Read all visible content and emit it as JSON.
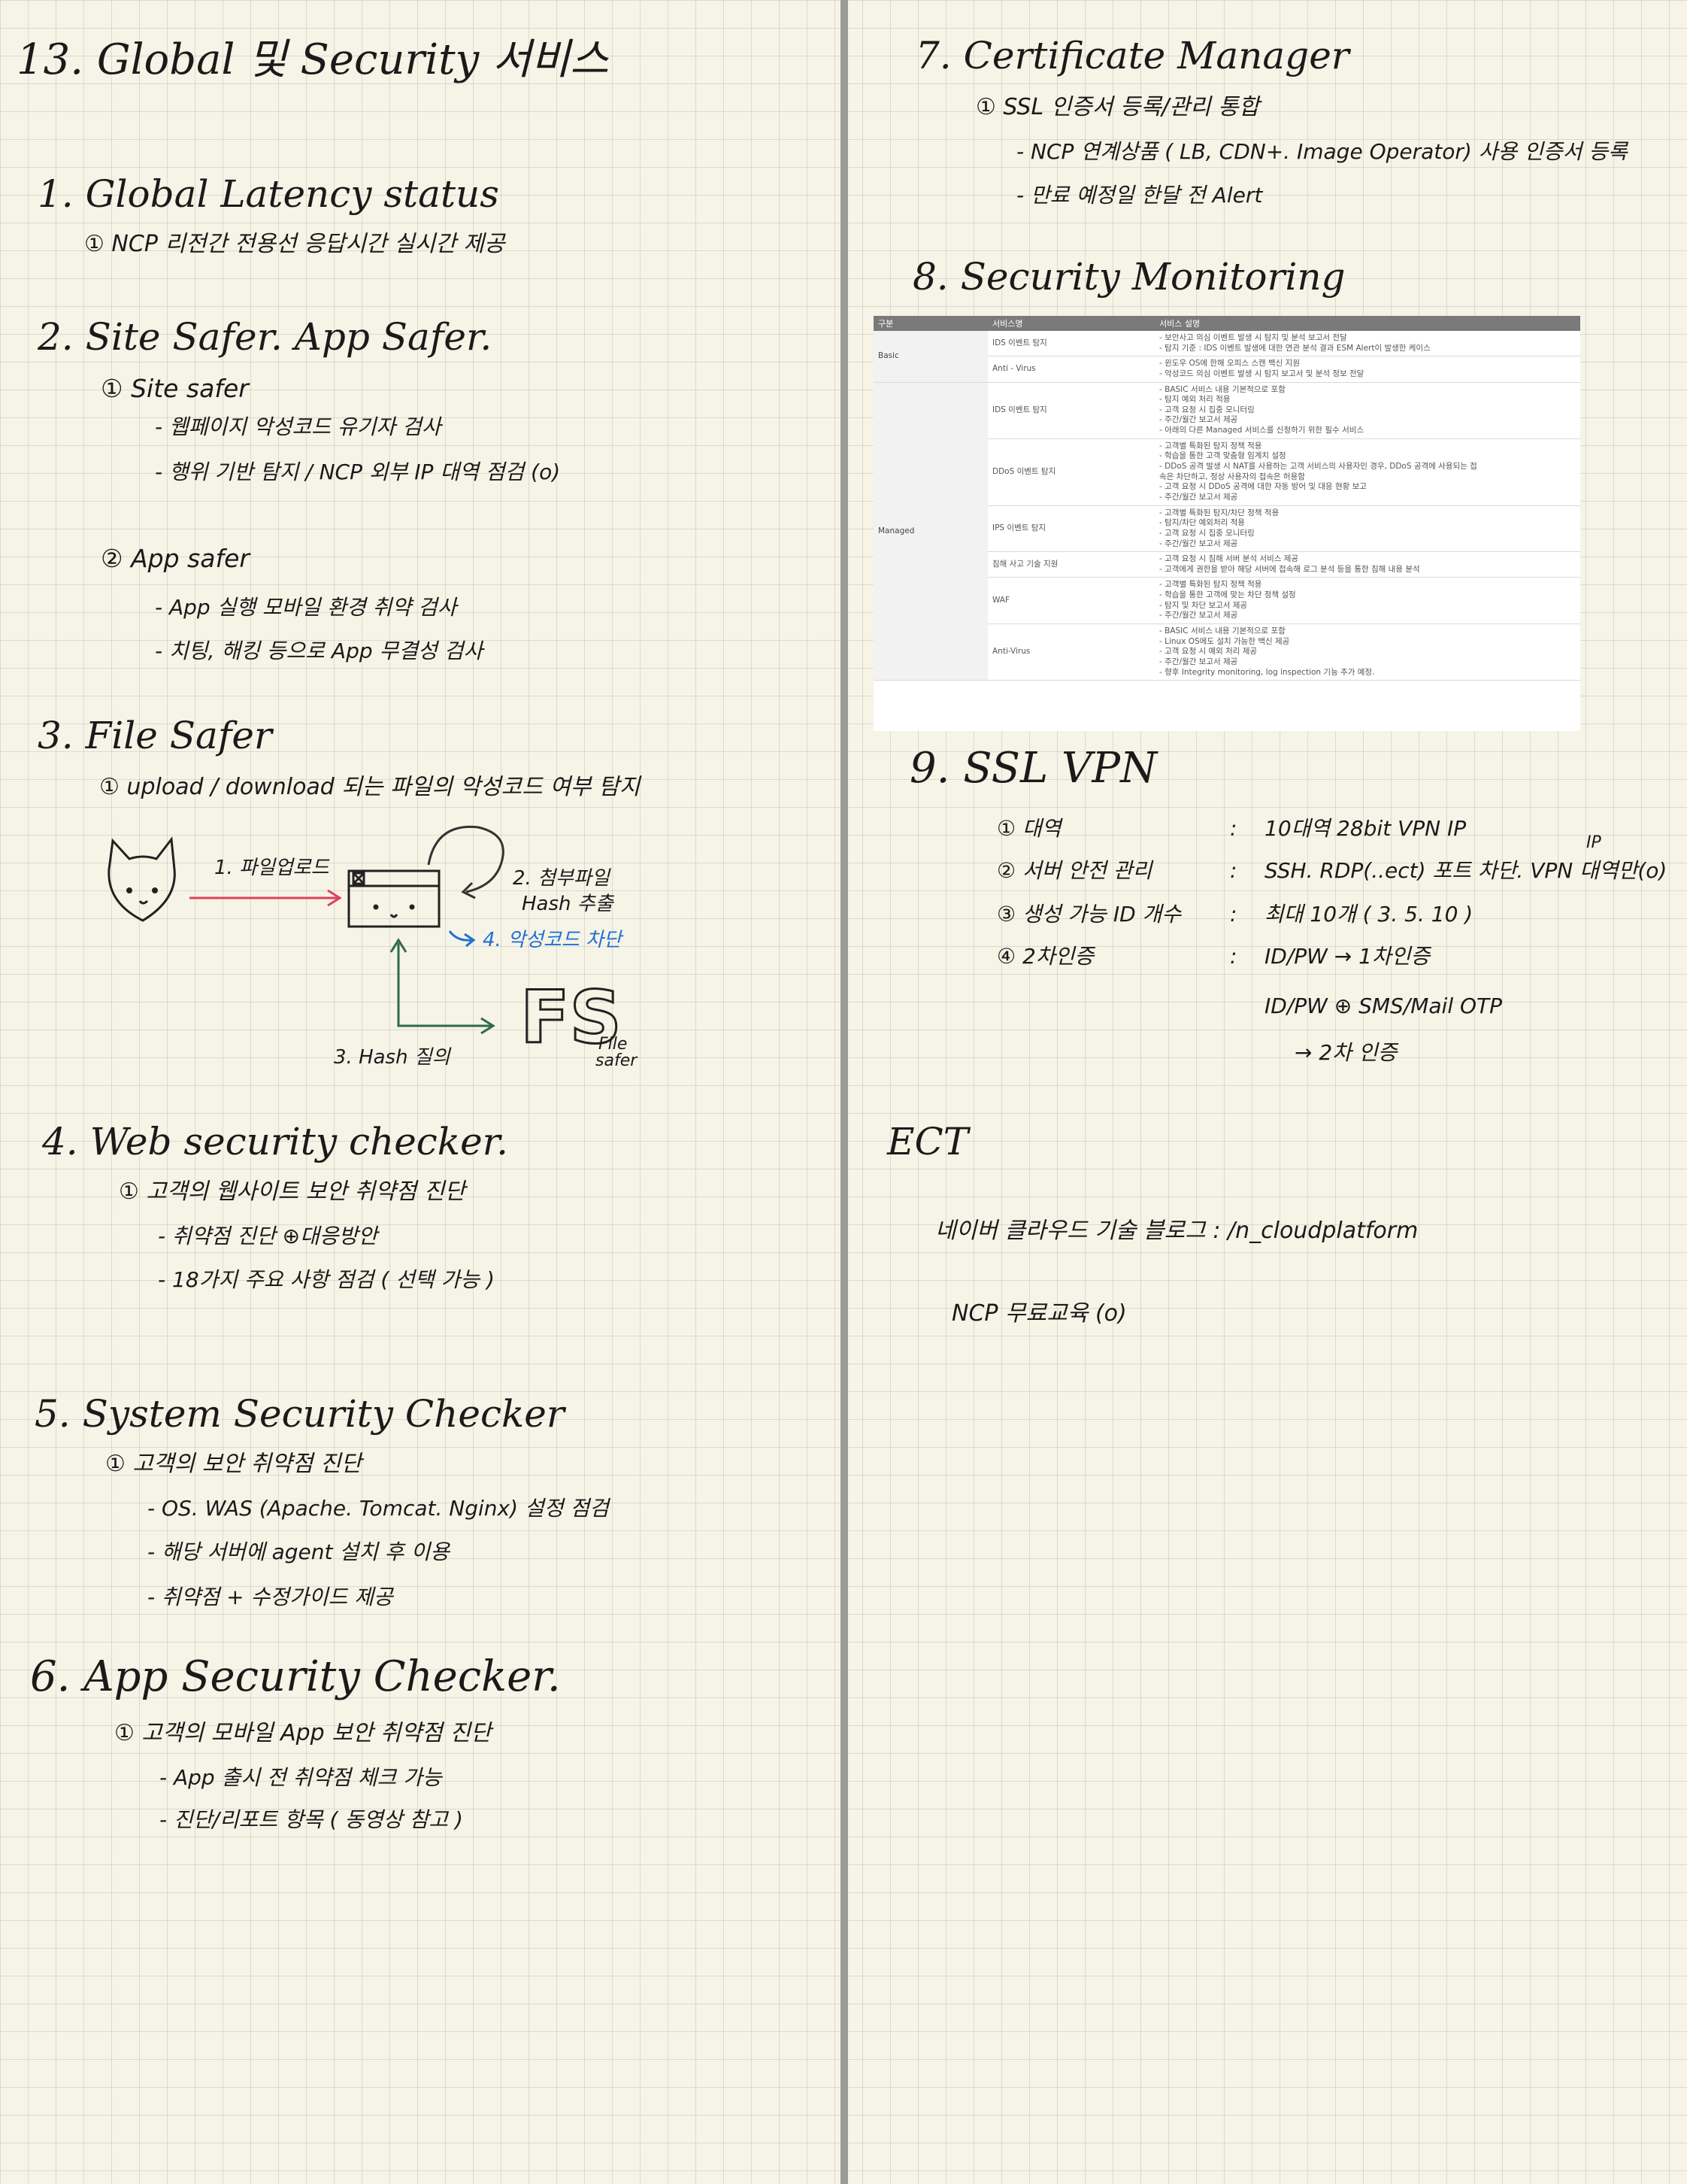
{
  "left": {
    "title": "13. Global 및 Security 서비스",
    "s1": {
      "heading": "1. Global Latency status",
      "item1": "① NCP 리전간 전용선 응답시간 실시간 제공"
    },
    "s2": {
      "heading": "2. Site Safer. App Safer.",
      "sub1": "① Site safer",
      "sub1_b1": "- 웹페이지 악성코드 유기자 검사",
      "sub1_b2": "- 행위 기반 탐지 / NCP 외부 IP 대역 점검 (o)",
      "sub2": "② App safer",
      "sub2_b1": "- App 실행 모바일 환경 취약 검사",
      "sub2_b2": "- 치팅, 해킹 등으로 App 무결성 검사"
    },
    "s3": {
      "heading": "3. File Safer",
      "item1": "① upload / download 되는 파일의 악성코드 여부 탐지",
      "diagram": {
        "step1": "1. 파일업로드",
        "step2a": "2. 첨부파일",
        "step2b": "Hash 추출",
        "step3": "3. Hash 질의",
        "step4": "4. 악성코드 차단",
        "logo": "FS",
        "logo_sub1": "File",
        "logo_sub2": "safer"
      }
    },
    "s4": {
      "heading": "4. Web security checker.",
      "item1": "① 고객의 웹사이트 보안 취약점 진단",
      "b1": "- 취약점 진단 ⊕대응방안",
      "b2": "- 18가지 주요 사항 점검 ( 선택 가능 )"
    },
    "s5": {
      "heading": "5. System Security Checker",
      "item1": "① 고객의 보안 취약점 진단",
      "b1": "- OS. WAS (Apache. Tomcat. Nginx) 설정 점검",
      "b2": "- 해당 서버에 agent 설치 후 이용",
      "b3": "- 취약점 + 수정가이드 제공"
    },
    "s6": {
      "heading": "6. App Security Checker.",
      "item1": "① 고객의 모바일 App 보안 취약점 진단",
      "b1": "- App 출시 전 취약점 체크 가능",
      "b2": "- 진단/리포트 항목 ( 동영상 참고 )"
    }
  },
  "right": {
    "s7": {
      "heading": "7. Certificate Manager",
      "item1": "① SSL 인증서 등록/관리 통합",
      "b1": "- NCP 연계상품 ( LB, CDN+. Image Operator) 사용 인증서 등록",
      "b2": "- 만료 예정일 한달 전 Alert"
    },
    "s8": {
      "heading": "8. Security Monitoring",
      "table": {
        "headers": [
          "구분",
          "서비스명",
          "서비스 설명"
        ],
        "groups": [
          {
            "category": "Basic",
            "rows": [
              {
                "service": "IDS 이벤트 탐지",
                "desc": [
                  "- 보안사고 의심 이벤트 발생 시 탐지 및 분석 보고서 전달",
                  "- 탐지 기준 : IDS 이벤트 발생에 대한 연관 분석 결과 ESM Alert이 발생한 케이스"
                ]
              },
              {
                "service": "Anti - Virus",
                "desc": [
                  "- 윈도우 OS에 한해 오피스 스캔 백신 지원",
                  "- 악성코드 의심 이벤트 발생 시 탐지 보고서 및 분석 정보 전달"
                ]
              }
            ]
          },
          {
            "category": "Managed",
            "rows": [
              {
                "service": "IDS 이벤트 탐지",
                "desc": [
                  "- BASIC 서비스 내용 기본적으로 포함",
                  "- 탐지 예외 처리 적용",
                  "- 고객 요청 시 집중 모니터링",
                  "- 주간/월간 보고서 제공",
                  "- 아래의 다른 Managed 서비스를 신청하기 위한 필수 서비스"
                ]
              },
              {
                "service": "DDoS 이벤트 탐지",
                "desc": [
                  "- 고객별 특화된 탐지 정책 적용",
                  "- 학습을 통한 고객 맞춤형 임계치 설정",
                  "- DDoS 공격 발생 시 NAT를 사용하는 고객 서비스의 사용자인 경우, DDoS 공격에 사용되는 접",
                  "속은 차단하고, 정상 사용자의 접속은 허용함",
                  "- 고객 요청 시 DDoS 공격에 대한 자동 방어 및 대응 현황 보고",
                  "- 주간/월간 보고서 제공"
                ]
              },
              {
                "service": "IPS 이벤트 탐지",
                "desc": [
                  "- 고객별 특화된 탐지/차단 정책 적용",
                  "- 탐지/차단 예외처리 적용",
                  "- 고객 요청 시 집중 모니터링",
                  "- 주간/월간 보고서 제공"
                ]
              },
              {
                "service": "침해 사고 기술 지원",
                "desc": [
                  "- 고객 요청 시 침해 서버 분석 서비스 제공",
                  "- 고객에게 권한을 받아 해당 서버에 접속해 로그 분석 등을 통한 침해 내용 분석"
                ]
              },
              {
                "service": "WAF",
                "desc": [
                  "- 고객별 특화된 탐지 정책 적용",
                  "- 학습을 통한 고객에 맞는 차단 정책 설정",
                  "- 탐지 및 차단 보고서 제공",
                  "- 주간/월간 보고서 제공"
                ]
              },
              {
                "service": "Anti-Virus",
                "desc": [
                  "- BASIC 서비스 내용 기본적으로 포함",
                  "- Linux OS에도 설치 가능한 백신 제공",
                  "- 고객 요청 시 예외 처리 제공",
                  "- 주간/월간 보고서 제공",
                  "- 향후 Integrity monitoring, log inspection 기능 추가 예정."
                ]
              }
            ]
          }
        ]
      }
    },
    "s9": {
      "heading": "9. SSL VPN",
      "rows": [
        {
          "label": "① 대역",
          "sep": ":",
          "value": "10대역 28bit VPN IP"
        },
        {
          "label": "② 서버 안전 관리",
          "sep": ":",
          "value": "SSH. RDP(..ect) 포트 차단. VPN 대역만(o)"
        },
        {
          "label": "③ 생성 가능 ID 개수",
          "sep": ":",
          "value": "최대 10개 ( 3. 5. 10 )"
        },
        {
          "label": "④ 2차인증",
          "sep": ":",
          "value": "ID/PW → 1차인증"
        }
      ],
      "ip_note": "IP",
      "extra1": "ID/PW ⊕ SMS/Mail OTP",
      "extra2": "→ 2차 인증"
    },
    "etc": {
      "heading": "ECT",
      "line1": "네이버 클라우드 기술 블로그 : /n_cloudplatform",
      "line2": "NCP 무료교육 (o)"
    }
  }
}
